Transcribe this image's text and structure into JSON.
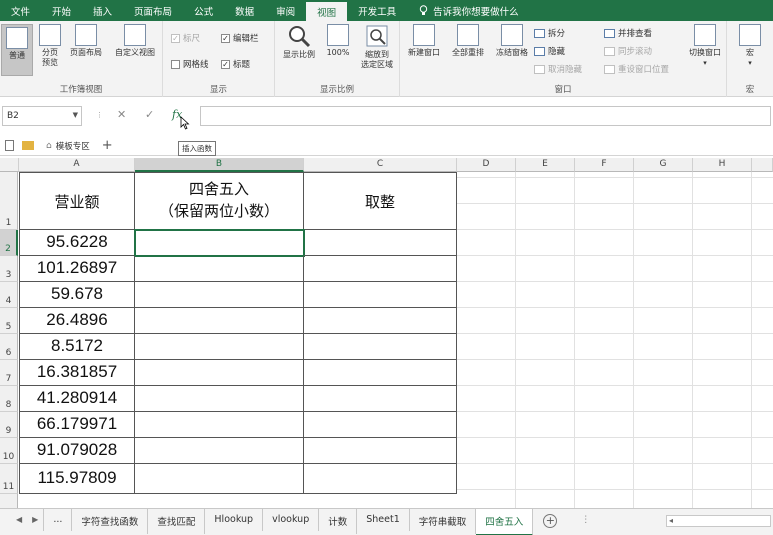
{
  "menu": {
    "tabs": [
      "文件",
      "开始",
      "插入",
      "页面布局",
      "公式",
      "数据",
      "审阅",
      "视图",
      "开发工具"
    ],
    "active_tab": "视图",
    "tell_me": "告诉我你想要做什么"
  },
  "ribbon": {
    "workbook_views": {
      "label": "工作簿视图",
      "normal": "普通",
      "page_break": "分页\n预览",
      "page_layout": "页面布局",
      "custom": "自定义视图"
    },
    "show": {
      "label": "显示",
      "ruler": "标尺",
      "formula_bar": "编辑栏",
      "gridlines": "网格线",
      "headings": "标题"
    },
    "zoom": {
      "label": "显示比例",
      "zoom": "显示比例",
      "hundred": "100%",
      "zoom_selection": "缩放到\n选定区域"
    },
    "window": {
      "label": "窗口",
      "new_window": "新建窗口",
      "arrange_all": "全部重排",
      "freeze": "冻结窗格",
      "split": "拆分",
      "hide": "隐藏",
      "unhide": "取消隐藏",
      "side_by_side": "并排查看",
      "sync_scroll": "同步滚动",
      "reset_position": "重设窗口位置",
      "switch": "切换窗口"
    },
    "macro": {
      "label": "宏",
      "macro": "宏"
    }
  },
  "formula_bar": {
    "name_box": "B2",
    "cancel": "✕",
    "enter": "✓",
    "fx": "fx",
    "value": ""
  },
  "workbook_tabs": {
    "template": "模板专区",
    "add": "+"
  },
  "tooltip": "插入函数",
  "columns": [
    "A",
    "B",
    "C",
    "D",
    "E",
    "F",
    "G",
    "H"
  ],
  "rows": [
    "1",
    "2",
    "3",
    "4",
    "5",
    "6",
    "7",
    "8",
    "9",
    "10",
    "11"
  ],
  "table": {
    "header_a": "营业额",
    "header_b_line1": "四舍五入",
    "header_b_line2": "（保留两位小数）",
    "header_c": "取整",
    "values": [
      "95.6228",
      "101.26897",
      "59.678",
      "26.4896",
      "8.5172",
      "16.381857",
      "41.280914",
      "66.179971",
      "91.079028",
      "115.97809"
    ]
  },
  "sheet_tabs": {
    "ellipsis": "...",
    "tabs": [
      "字符查找函数",
      "查找匹配",
      "Hlookup",
      "vlookup",
      "计数",
      "Sheet1",
      "字符串截取",
      "四舍五入"
    ],
    "active": "四舍五入"
  },
  "colors": {
    "brand": "#217346",
    "grid_line": "#e1e1e1"
  }
}
